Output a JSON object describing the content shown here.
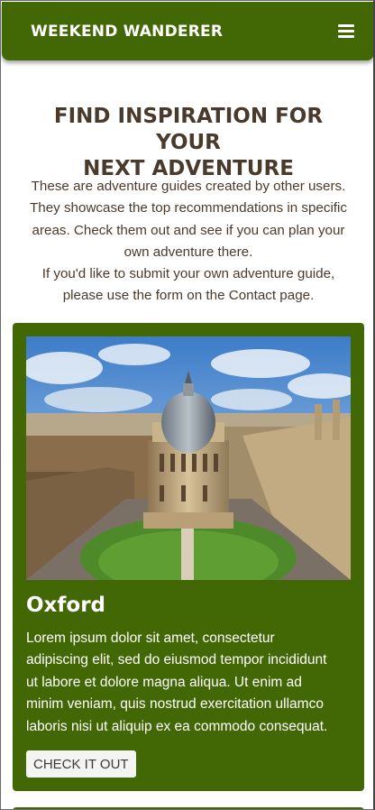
{
  "navbar": {
    "brand": "WEEKEND WANDERER",
    "menu_icon": "hamburger-menu-icon"
  },
  "main": {
    "heading_line1": "FIND INSPIRATION FOR YOUR",
    "heading_line2": "NEXT ADVENTURE",
    "intro_lines": [
      "These are adventure guides created by other users.",
      "They showcase the top recommendations in specific",
      "areas. Check them out and see if you can plan your",
      "own adventure there.",
      "If you'd like to submit your own adventure guide,",
      "please use the form on the Contact page."
    ]
  },
  "cards": [
    {
      "title": "Oxford",
      "text_lines": [
        "Lorem ipsum dolor sit amet, consectetur",
        "adipiscing elit, sed do eiusmod tempor incididunt",
        "ut labore et dolore magna aliqua. Ut enim ad",
        "minim veniam, quis nostrud exercitation ullamco",
        "laboris nisi ut aliquip ex ea commodo consequat."
      ],
      "button_label": "CHECK IT OUT",
      "image_subject": "oxford-radcliffe-camera-photo"
    }
  ],
  "colors": {
    "brand_green": "#426805",
    "heading_brown": "#4a3a2c",
    "button_bg": "#f4f4f2"
  }
}
